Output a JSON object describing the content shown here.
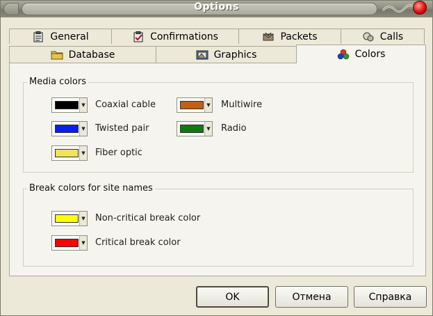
{
  "window": {
    "title": "Options"
  },
  "tabs_back": [
    {
      "label": "General",
      "icon": "clipboard-icon"
    },
    {
      "label": "Confirmations",
      "icon": "confirmations-icon"
    },
    {
      "label": "Packets",
      "icon": "packets-icon"
    },
    {
      "label": "Calls",
      "icon": "calls-icon"
    }
  ],
  "tabs_front": [
    {
      "label": "Database",
      "icon": "folder-icon"
    },
    {
      "label": "Graphics",
      "icon": "graphics-icon"
    },
    {
      "label": "Colors",
      "icon": "colors-icon",
      "active": true
    }
  ],
  "media": {
    "label": "Media colors",
    "items": [
      {
        "label": "Coaxial cable",
        "color": "#000000"
      },
      {
        "label": "Multiwire",
        "color": "#c25f12"
      },
      {
        "label": "Twisted pair",
        "color": "#0a1ef0"
      },
      {
        "label": "Radio",
        "color": "#107a10"
      },
      {
        "label": "Fiber optic",
        "color": "#efe35a"
      }
    ]
  },
  "breaks": {
    "label": "Break colors for site names",
    "items": [
      {
        "label": "Non-critical break color",
        "color": "#ffff00"
      },
      {
        "label": "Critical break color",
        "color": "#ff0000"
      }
    ]
  },
  "buttons": {
    "ok": "OK",
    "cancel": "Отмена",
    "help": "Справка"
  }
}
